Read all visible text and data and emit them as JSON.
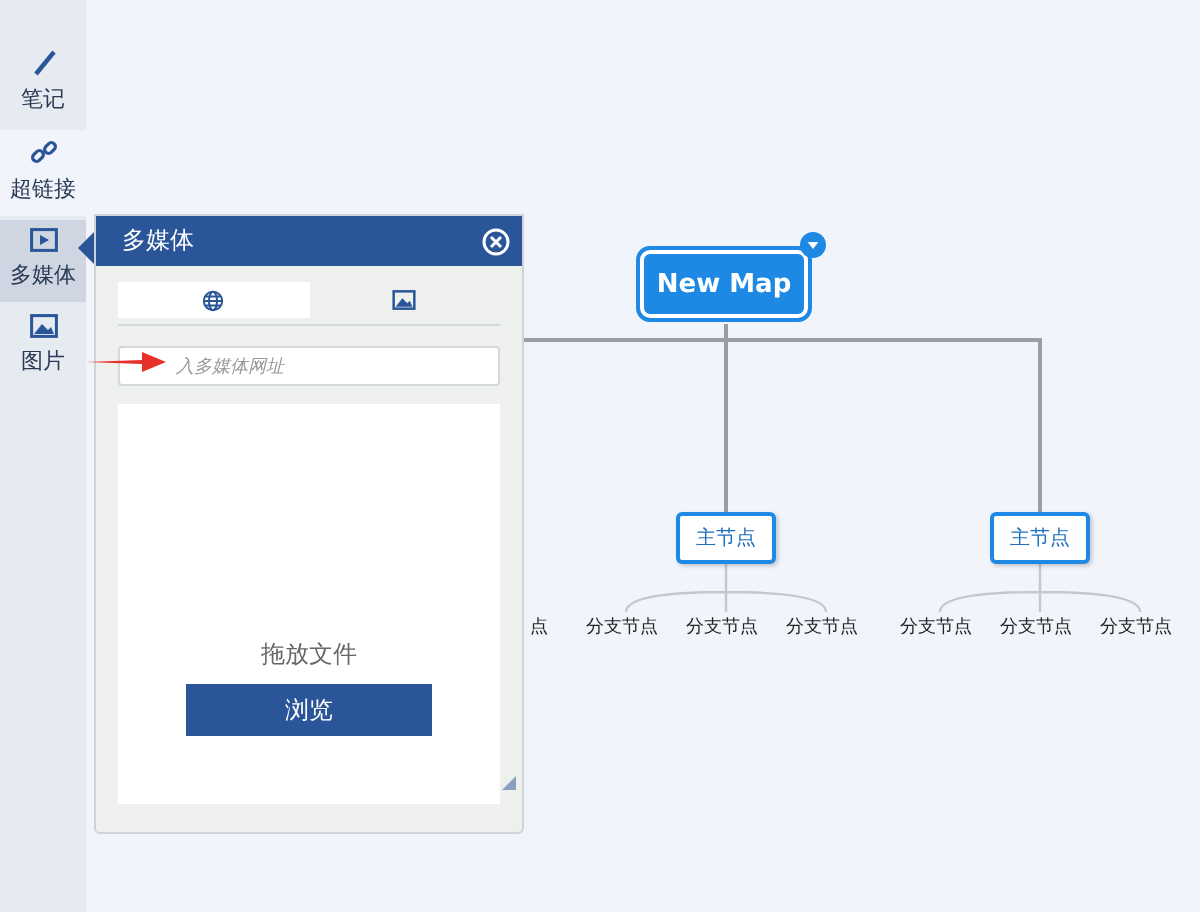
{
  "sidebar": {
    "items": [
      {
        "label": "笔记",
        "kind": "pen",
        "selected": false
      },
      {
        "label": "超链接",
        "kind": "link",
        "selected": false
      },
      {
        "label": "多媒体",
        "kind": "media",
        "selected": true
      },
      {
        "label": "图片",
        "kind": "image",
        "selected": false
      }
    ]
  },
  "panel": {
    "title": "多媒体",
    "tabs": [
      {
        "kind": "web",
        "selected": true
      },
      {
        "kind": "image",
        "selected": false
      }
    ],
    "url_field": {
      "placeholder": "入多媒体网址"
    },
    "drop_text": "拖放文件",
    "browse_button": "浏览"
  },
  "map": {
    "root": "New Map",
    "partial_branch": "点",
    "main_nodes": [
      {
        "label": "主节点",
        "branches": [
          "分支节点",
          "分支节点",
          "分支节点"
        ]
      },
      {
        "label": "主节点",
        "branches": [
          "分支节点",
          "分支节点",
          "分支节点"
        ]
      }
    ]
  }
}
